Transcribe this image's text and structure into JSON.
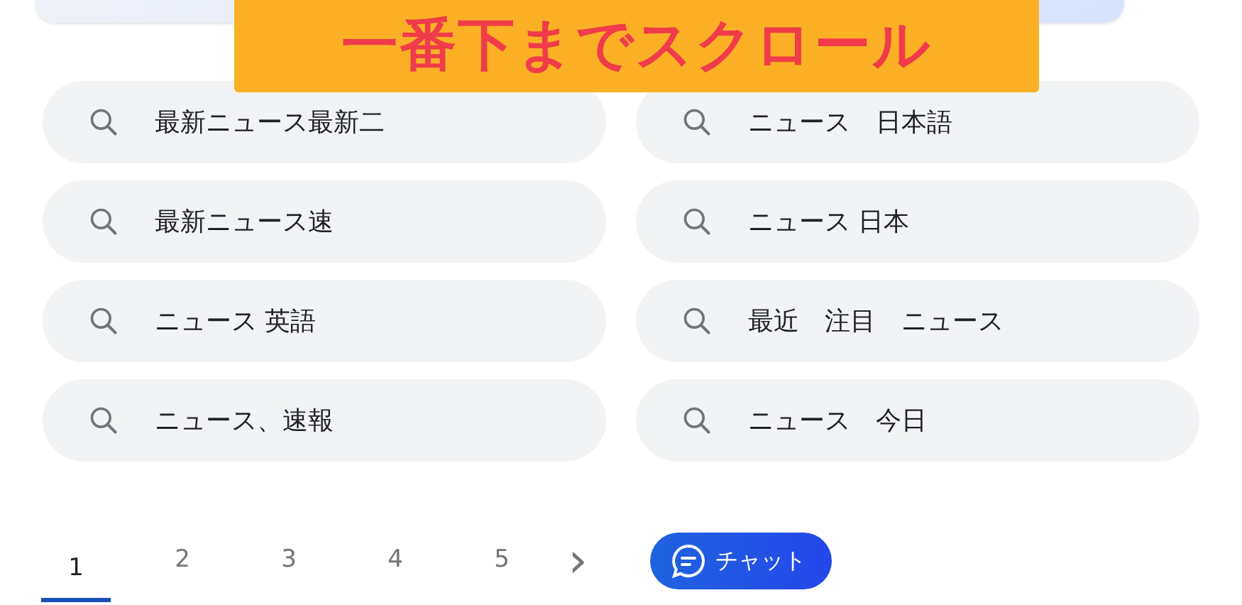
{
  "banner": {
    "text": "一番下までスクロール"
  },
  "related_searches": [
    {
      "text": "最新ニュース最新二"
    },
    {
      "text": "ニュース　日本語"
    },
    {
      "text": "最新ニュース速"
    },
    {
      "text": "ニュース 日本"
    },
    {
      "text": "ニュース 英語"
    },
    {
      "text": "最近　注目　ニュース"
    },
    {
      "text": "ニュース、速報"
    },
    {
      "text": "ニュース　今日"
    }
  ],
  "pagination": {
    "pages": [
      {
        "label": "1",
        "selected": true
      },
      {
        "label": "2",
        "selected": false
      },
      {
        "label": "3",
        "selected": false
      },
      {
        "label": "4",
        "selected": false
      },
      {
        "label": "5",
        "selected": false
      }
    ],
    "next": "›"
  },
  "chat_button": {
    "label": "チャット"
  }
}
